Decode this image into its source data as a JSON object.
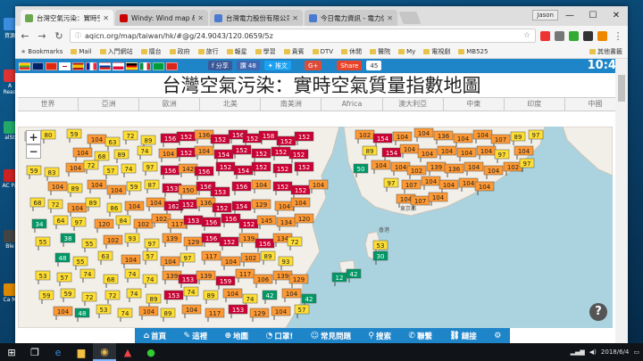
{
  "desktop": {
    "icons": [
      {
        "label": "資源",
        "color": "#3c8dde"
      },
      {
        "label": "A Read",
        "color": "#d33"
      },
      {
        "label": "alSt",
        "color": "#2a6"
      },
      {
        "label": "AC Pa",
        "color": "#c22"
      },
      {
        "label": "Ble",
        "color": "#444"
      },
      {
        "label": "Ca M",
        "color": "#d80"
      }
    ]
  },
  "browser": {
    "tabs": [
      {
        "title": "台灣空氣污染：實時空氣",
        "active": true,
        "favicon_color": "#6aa84f"
      },
      {
        "title": "Windy: Wind map & we",
        "active": false,
        "favicon_color": "#c00"
      },
      {
        "title": "台灣電力股份有限公司",
        "active": false,
        "favicon_color": "#4a7bd0"
      },
      {
        "title": "今日電力資訊 - 電力供需",
        "active": false,
        "favicon_color": "#4a7bd0"
      }
    ],
    "profile": "Jason",
    "url": "aqicn.org/map/taiwan/hk/#@g/24.9043/120.0659/5z",
    "bookmarks": [
      "Bookmarks",
      "Mail",
      "入門網站",
      "擂台",
      "政府",
      "旅行",
      "報星",
      "學習",
      "貴賓",
      "DTV",
      "休閒",
      "醫院",
      "My",
      "電視劇",
      "MB525"
    ],
    "bookmarks_end": "其他書籤"
  },
  "page": {
    "facebook_label": "分享",
    "like_label": "讚 48",
    "twitter_label": "推文",
    "gplus_label": "G+",
    "share_label": "Share",
    "share_count": "45",
    "clock": "10:45",
    "title": "台灣空氣污染：實時空氣質量指數地圖",
    "regions": [
      "世界",
      "亞洲",
      "歐洲",
      "北美",
      "南美洲",
      "Africa",
      "澳大利亞",
      "中東",
      "印度",
      "中國"
    ],
    "zoom_in": "+",
    "zoom_out": "−",
    "help": "?",
    "bottom_nav": [
      {
        "icon": "home-icon",
        "glyph": "⌂",
        "label": "首頁"
      },
      {
        "icon": "leaf-icon",
        "glyph": "✎",
        "label": "這裡"
      },
      {
        "icon": "map-icon",
        "glyph": "⊕",
        "label": "地圖"
      },
      {
        "icon": "mask-icon",
        "glyph": "◔",
        "label": "口罩!"
      },
      {
        "icon": "chat-icon",
        "glyph": "☺",
        "label": "常見問題"
      },
      {
        "icon": "search-icon",
        "glyph": "⚲",
        "label": "搜索"
      },
      {
        "icon": "contact-icon",
        "glyph": "✆",
        "label": "聯繫"
      },
      {
        "icon": "link-icon",
        "glyph": "⛓",
        "label": "鏈接"
      },
      {
        "icon": "gear-icon",
        "glyph": "⚙",
        "label": ""
      }
    ],
    "map_labels": [
      "東京都",
      "香港"
    ],
    "stations": [
      [
        8,
        6,
        "72"
      ],
      [
        26,
        4,
        "80"
      ],
      [
        55,
        3,
        "59"
      ],
      [
        78,
        9,
        "104"
      ],
      [
        98,
        12,
        "63"
      ],
      [
        118,
        5,
        "72"
      ],
      [
        138,
        10,
        "89"
      ],
      [
        160,
        8,
        "156"
      ],
      [
        178,
        6,
        "152"
      ],
      [
        198,
        4,
        "136"
      ],
      [
        216,
        9,
        "152"
      ],
      [
        236,
        4,
        "156"
      ],
      [
        252,
        8,
        "152"
      ],
      [
        270,
        5,
        "158"
      ],
      [
        290,
        11,
        "152"
      ],
      [
        310,
        6,
        "152"
      ],
      [
        62,
        24,
        "104"
      ],
      [
        86,
        28,
        "68"
      ],
      [
        108,
        26,
        "89"
      ],
      [
        134,
        22,
        "74"
      ],
      [
        158,
        25,
        "104"
      ],
      [
        178,
        24,
        "152"
      ],
      [
        198,
        22,
        "104"
      ],
      [
        220,
        26,
        "154"
      ],
      [
        240,
        21,
        "152"
      ],
      [
        262,
        25,
        "152"
      ],
      [
        284,
        23,
        "152"
      ],
      [
        304,
        26,
        "152"
      ],
      [
        10,
        44,
        "59"
      ],
      [
        30,
        46,
        "83"
      ],
      [
        54,
        41,
        "104"
      ],
      [
        74,
        38,
        "72"
      ],
      [
        96,
        44,
        "57"
      ],
      [
        116,
        42,
        "74"
      ],
      [
        140,
        40,
        "97"
      ],
      [
        160,
        44,
        "156"
      ],
      [
        180,
        42,
        "142"
      ],
      [
        198,
        45,
        "156"
      ],
      [
        222,
        40,
        "152"
      ],
      [
        242,
        44,
        "154"
      ],
      [
        262,
        40,
        "152"
      ],
      [
        286,
        42,
        "152"
      ],
      [
        310,
        40,
        "152"
      ],
      [
        34,
        62,
        "104"
      ],
      [
        56,
        64,
        "89"
      ],
      [
        78,
        60,
        "104"
      ],
      [
        100,
        66,
        "104"
      ],
      [
        122,
        62,
        "59"
      ],
      [
        142,
        60,
        "87"
      ],
      [
        162,
        64,
        "153"
      ],
      [
        180,
        66,
        "150"
      ],
      [
        200,
        62,
        "156"
      ],
      [
        216,
        68,
        "153"
      ],
      [
        240,
        62,
        "156"
      ],
      [
        262,
        60,
        "104"
      ],
      [
        286,
        62,
        "152"
      ],
      [
        306,
        66,
        "152"
      ],
      [
        326,
        60,
        "104"
      ],
      [
        14,
        80,
        "68"
      ],
      [
        34,
        82,
        "72"
      ],
      [
        56,
        86,
        "104"
      ],
      [
        76,
        80,
        "89"
      ],
      [
        100,
        86,
        "86"
      ],
      [
        120,
        84,
        "104"
      ],
      [
        144,
        80,
        "104"
      ],
      [
        164,
        84,
        "162"
      ],
      [
        180,
        82,
        "152"
      ],
      [
        200,
        80,
        "136"
      ],
      [
        218,
        86,
        "152"
      ],
      [
        240,
        84,
        "154"
      ],
      [
        262,
        82,
        "129"
      ],
      [
        288,
        84,
        "104"
      ],
      [
        306,
        80,
        "104"
      ],
      [
        16,
        104,
        "34"
      ],
      [
        40,
        100,
        "64"
      ],
      [
        60,
        102,
        "97"
      ],
      [
        86,
        104,
        "120"
      ],
      [
        110,
        100,
        "84"
      ],
      [
        130,
        104,
        "102"
      ],
      [
        150,
        98,
        "102"
      ],
      [
        168,
        104,
        "117"
      ],
      [
        186,
        100,
        "153"
      ],
      [
        206,
        102,
        "156"
      ],
      [
        228,
        98,
        "156"
      ],
      [
        248,
        104,
        "152"
      ],
      [
        268,
        100,
        "145"
      ],
      [
        290,
        102,
        "134"
      ],
      [
        310,
        98,
        "120"
      ],
      [
        20,
        124,
        "55"
      ],
      [
        48,
        120,
        "38"
      ],
      [
        72,
        126,
        "55"
      ],
      [
        96,
        122,
        "102"
      ],
      [
        120,
        120,
        "93"
      ],
      [
        142,
        126,
        "97"
      ],
      [
        162,
        120,
        "139"
      ],
      [
        186,
        124,
        "129"
      ],
      [
        206,
        120,
        "156"
      ],
      [
        226,
        124,
        "152"
      ],
      [
        248,
        120,
        "139"
      ],
      [
        266,
        126,
        "156"
      ],
      [
        286,
        120,
        "134"
      ],
      [
        302,
        124,
        "72"
      ],
      [
        42,
        142,
        "48"
      ],
      [
        62,
        146,
        "55"
      ],
      [
        90,
        140,
        "63"
      ],
      [
        116,
        144,
        "104"
      ],
      [
        140,
        140,
        "57"
      ],
      [
        160,
        146,
        "104"
      ],
      [
        182,
        142,
        "97"
      ],
      [
        206,
        140,
        "117"
      ],
      [
        228,
        146,
        "104"
      ],
      [
        250,
        142,
        "102"
      ],
      [
        272,
        140,
        "89"
      ],
      [
        292,
        146,
        "93"
      ],
      [
        20,
        162,
        "53"
      ],
      [
        44,
        164,
        "57"
      ],
      [
        70,
        160,
        "74"
      ],
      [
        96,
        166,
        "68"
      ],
      [
        120,
        160,
        "74"
      ],
      [
        140,
        166,
        "74"
      ],
      [
        162,
        162,
        "139"
      ],
      [
        180,
        166,
        "153"
      ],
      [
        200,
        162,
        "139"
      ],
      [
        222,
        168,
        "159"
      ],
      [
        244,
        160,
        "117"
      ],
      [
        264,
        166,
        "106"
      ],
      [
        286,
        162,
        "139"
      ],
      [
        304,
        166,
        "129"
      ],
      [
        24,
        184,
        "59"
      ],
      [
        48,
        182,
        "59"
      ],
      [
        72,
        186,
        "72"
      ],
      [
        98,
        184,
        "72"
      ],
      [
        122,
        182,
        "74"
      ],
      [
        144,
        188,
        "89"
      ],
      [
        164,
        184,
        "153"
      ],
      [
        186,
        180,
        "74"
      ],
      [
        208,
        184,
        "89"
      ],
      [
        230,
        182,
        "104"
      ],
      [
        252,
        188,
        "74"
      ],
      [
        274,
        184,
        "42"
      ],
      [
        296,
        182,
        "104"
      ],
      [
        318,
        188,
        "42"
      ],
      [
        40,
        202,
        "104"
      ],
      [
        64,
        204,
        "48"
      ],
      [
        88,
        200,
        "53"
      ],
      [
        112,
        204,
        "74"
      ],
      [
        136,
        202,
        "104"
      ],
      [
        160,
        204,
        "89"
      ],
      [
        184,
        200,
        "104"
      ],
      [
        210,
        204,
        "117"
      ],
      [
        236,
        200,
        "153"
      ],
      [
        260,
        204,
        "129"
      ],
      [
        284,
        202,
        "104"
      ],
      [
        310,
        200,
        "57"
      ],
      [
        378,
        4,
        "102"
      ],
      [
        398,
        8,
        "154"
      ],
      [
        420,
        6,
        "104"
      ],
      [
        444,
        2,
        "104"
      ],
      [
        466,
        5,
        "136"
      ],
      [
        488,
        8,
        "104"
      ],
      [
        510,
        4,
        "104"
      ],
      [
        530,
        9,
        "107"
      ],
      [
        552,
        6,
        "89"
      ],
      [
        572,
        4,
        "97"
      ],
      [
        386,
        22,
        "89"
      ],
      [
        408,
        24,
        "154"
      ],
      [
        428,
        20,
        "104"
      ],
      [
        448,
        25,
        "104"
      ],
      [
        470,
        22,
        "104"
      ],
      [
        492,
        24,
        "104"
      ],
      [
        514,
        22,
        "104"
      ],
      [
        534,
        26,
        "97"
      ],
      [
        556,
        22,
        "104"
      ],
      [
        376,
        42,
        "50"
      ],
      [
        396,
        38,
        "104"
      ],
      [
        418,
        40,
        "104"
      ],
      [
        436,
        44,
        "102"
      ],
      [
        458,
        40,
        "139"
      ],
      [
        478,
        42,
        "136"
      ],
      [
        500,
        40,
        "104"
      ],
      [
        522,
        44,
        "104"
      ],
      [
        544,
        40,
        "102"
      ],
      [
        562,
        36,
        "97"
      ],
      [
        410,
        58,
        "97"
      ],
      [
        430,
        60,
        "107"
      ],
      [
        452,
        56,
        "104"
      ],
      [
        472,
        60,
        "104"
      ],
      [
        494,
        58,
        "104"
      ],
      [
        512,
        62,
        "104"
      ],
      [
        424,
        76,
        "104"
      ],
      [
        440,
        78,
        "107"
      ],
      [
        460,
        74,
        "104"
      ],
      [
        398,
        128,
        "53"
      ],
      [
        398,
        140,
        "30"
      ],
      [
        352,
        164,
        "12"
      ],
      [
        368,
        160,
        "42"
      ]
    ]
  }
}
